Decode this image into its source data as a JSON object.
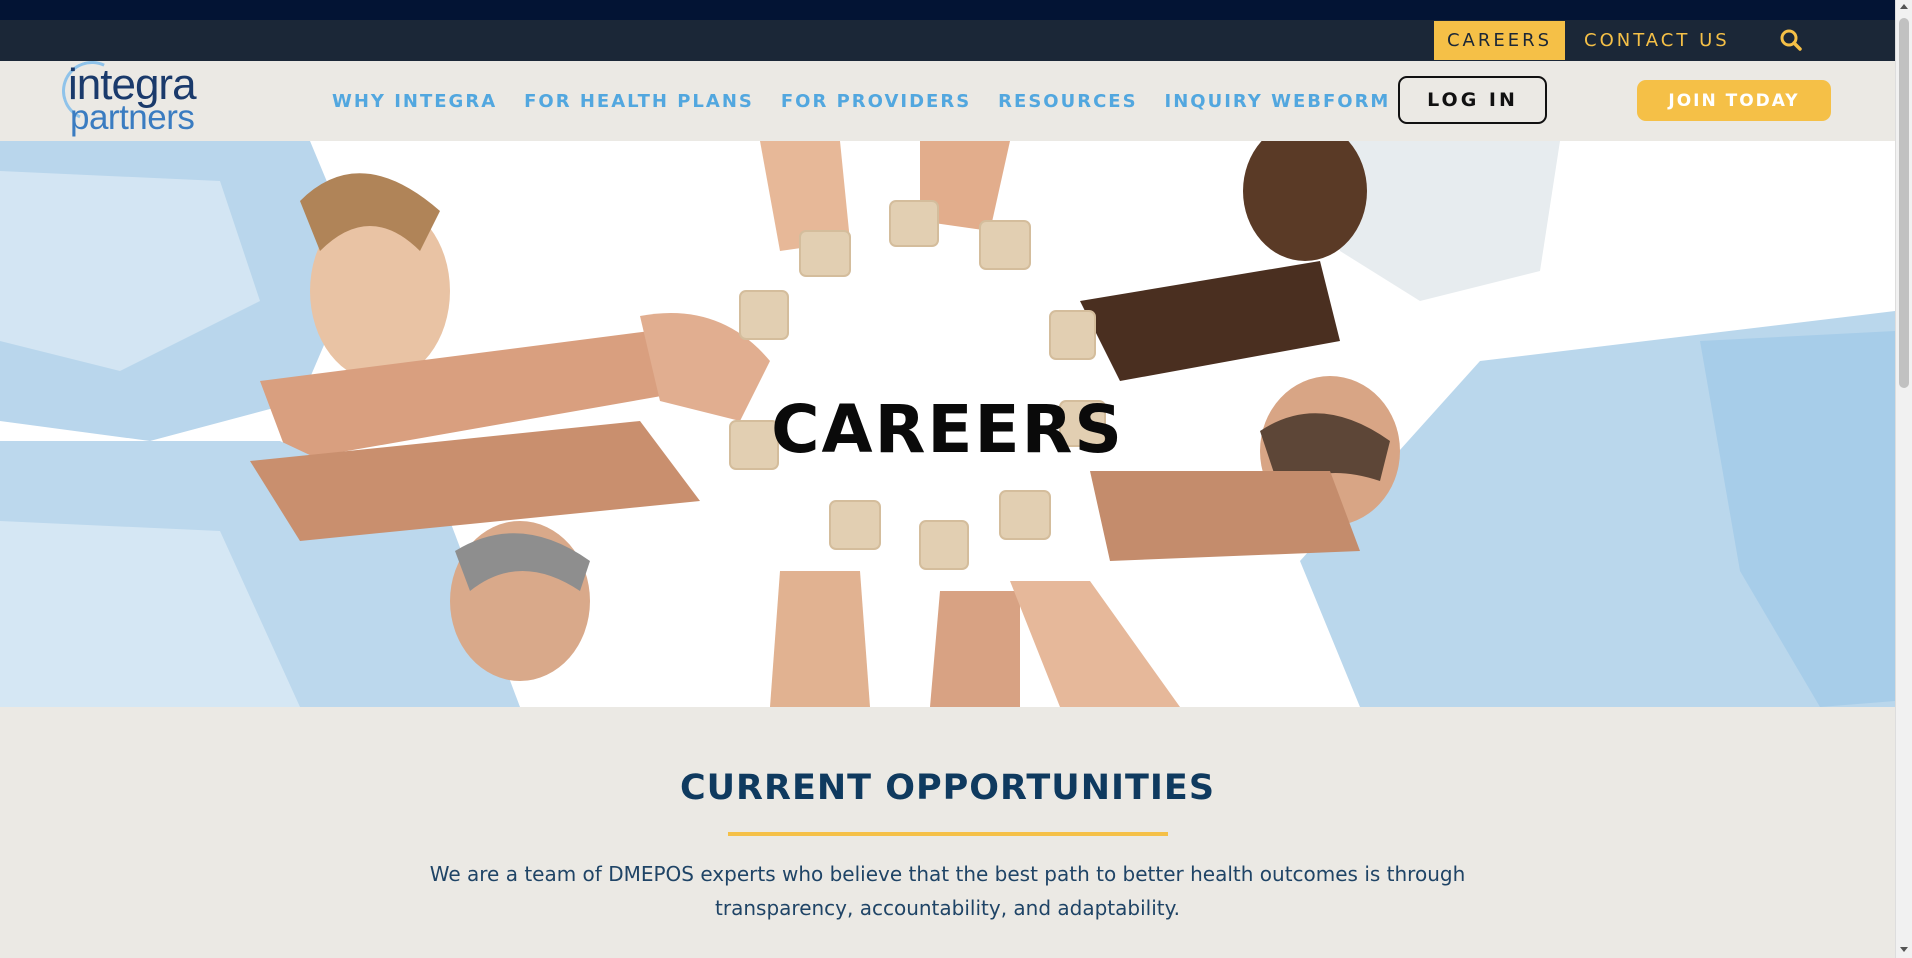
{
  "utility_nav": {
    "careers": "CAREERS",
    "contact": "CONTACT US",
    "search_icon": "search-icon"
  },
  "logo": {
    "line1": "integra",
    "line2": "partners"
  },
  "main_nav": {
    "links": [
      {
        "label": "WHY INTEGRA"
      },
      {
        "label": "FOR HEALTH PLANS"
      },
      {
        "label": "FOR PROVIDERS"
      },
      {
        "label": "RESOURCES"
      },
      {
        "label": "INQUIRY WEBFORM"
      }
    ],
    "login": "LOG IN",
    "join": "JOIN TODAY"
  },
  "hero": {
    "title": "CAREERS"
  },
  "opportunities": {
    "title": "CURRENT OPPORTUNITIES",
    "text": "We are a team of DMEPOS experts who believe that the best path to better health outcomes is through transparency, accountability, and adaptability."
  },
  "colors": {
    "accent": "#f5c047",
    "navy": "#031434",
    "utility_bar": "#1b2737",
    "nav_link": "#52a7df",
    "heading": "#0f3a5f",
    "background": "#ebe9e4"
  }
}
